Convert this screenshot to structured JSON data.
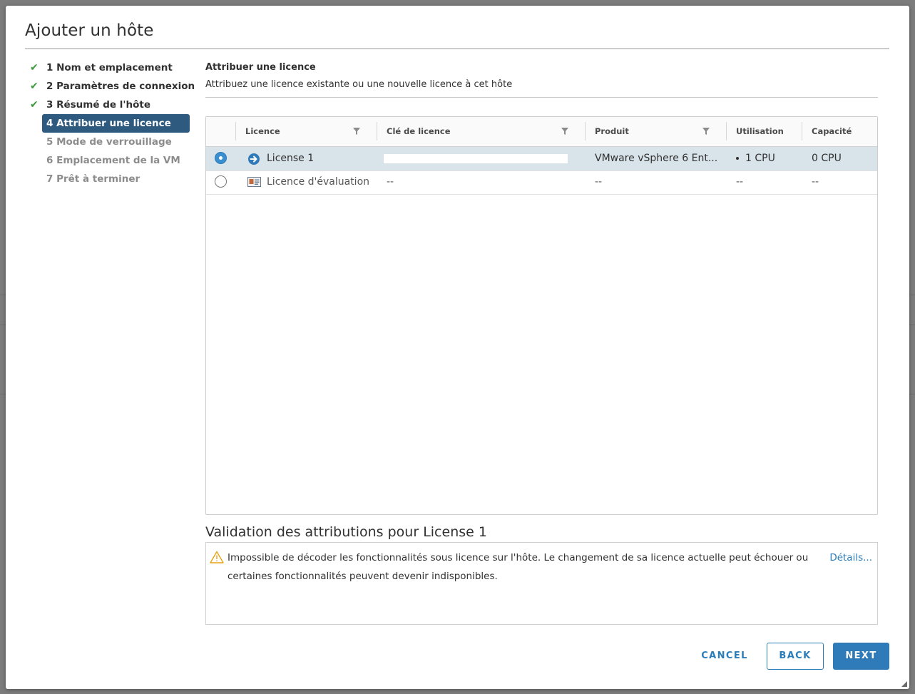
{
  "dialog": {
    "title": "Ajouter un hôte"
  },
  "steps": [
    {
      "label": "1 Nom et emplacement",
      "state": "done"
    },
    {
      "label": "2 Paramètres de connexion",
      "state": "done"
    },
    {
      "label": "3 Résumé de l'hôte",
      "state": "done"
    },
    {
      "label": "4 Attribuer une licence",
      "state": "current"
    },
    {
      "label": "5 Mode de verrouillage",
      "state": "future"
    },
    {
      "label": "6 Emplacement de la VM",
      "state": "future"
    },
    {
      "label": "7 Prêt à terminer",
      "state": "future"
    }
  ],
  "page": {
    "title": "Attribuer une licence",
    "subtitle": "Attribuez une licence existante ou une nouvelle licence à cet hôte"
  },
  "grid": {
    "columns": {
      "licence": "Licence",
      "key": "Clé de licence",
      "product": "Produit",
      "usage": "Utilisation",
      "capacity": "Capacité"
    },
    "rows": [
      {
        "selected": true,
        "icon": "license-arrow-icon",
        "licence": "License 1",
        "key": "",
        "product": "VMware vSphere 6 Ent...",
        "usage": "1 CPU",
        "capacity": "0 CPU"
      },
      {
        "selected": false,
        "icon": "evaluation-license-icon",
        "licence": "Licence d'évaluation",
        "key": "--",
        "product": "--",
        "usage": "--",
        "capacity": "--"
      }
    ]
  },
  "validation": {
    "title": "Validation des attributions pour License 1",
    "message": "Impossible de décoder les fonctionnalités sous licence sur l'hôte. Le changement de sa licence actuelle peut échouer ou certaines fonctionnalités peuvent devenir indisponibles.",
    "details_link": "Détails..."
  },
  "buttons": {
    "cancel": "CANCEL",
    "back": "BACK",
    "next": "NEXT"
  },
  "colors": {
    "accent": "#2b7dba",
    "current_step": "#2f5a80",
    "selected_row": "#d9e3ea",
    "check": "#3c9a3c",
    "warning": "#e8a317"
  }
}
